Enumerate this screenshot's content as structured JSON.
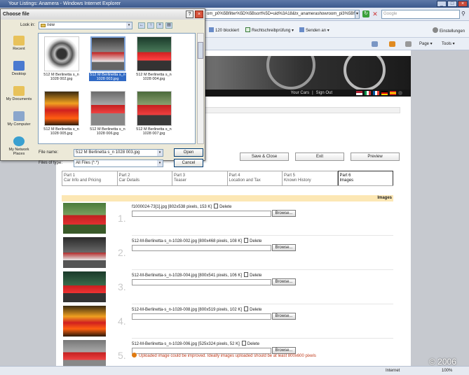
{
  "window": {
    "title": "Your Listings: Anamera - Windows Internet Explorer",
    "address": "om_p0%5Bfilter%5D%5Bsort%5D=uid%3A18&tx_anamerashowroom_pi3%5Bfilter",
    "search_placeholder": "Google"
  },
  "toolbar": {
    "items": [
      "120 blockiert",
      "Rechtschreibprüfung",
      "Senden an",
      "Einstellungen"
    ]
  },
  "nav": {
    "items": [
      "Page",
      "Tools"
    ]
  },
  "banner": {
    "your_cars": "Your Cars",
    "separator": "|",
    "sign_out": "Sign Out"
  },
  "actions": {
    "save_close": "Save & Close",
    "exit": "Exit",
    "preview": "Preview"
  },
  "tabs": [
    {
      "part": "Part 1",
      "label": "Car Info and Pricing"
    },
    {
      "part": "Part 2",
      "label": "Car Details"
    },
    {
      "part": "Part 3",
      "label": "Teaser"
    },
    {
      "part": "Part 4",
      "label": "Location and Tax"
    },
    {
      "part": "Part 5",
      "label": "Known History"
    },
    {
      "part": "Part 6",
      "label": "Images"
    }
  ],
  "images_section": {
    "header": "Images",
    "delete_label": "Delete",
    "browse_label": "Browse...",
    "rows": [
      {
        "num": "1.",
        "info": "f1000024-73[1].jpg [802x538 pixels, 153 K]"
      },
      {
        "num": "2.",
        "info": "512-M-Berlinetta-s_n-1028-002.jpg [800x468 pixels, 108 K]"
      },
      {
        "num": "3.",
        "info": "512-M-Berlinetta-s_n-1028-004.jpg [800x541 pixels, 106 K]"
      },
      {
        "num": "4.",
        "info": "512-M-Berlinetta-s_n-1028-008.jpg [800x519 pixels, 102 K]"
      },
      {
        "num": "5.",
        "info": "512-M-Berlinetta-s_n-1028-006.jpg [525x324 pixels, 52 K]"
      }
    ],
    "warning": "Uploaded image could be improved. Ideally images uploaded should be at least 800x600 pixels"
  },
  "copyright": "© 2006",
  "status": {
    "zone": "Internet",
    "zoom": "100%"
  },
  "dialog": {
    "title": "Choose file",
    "look_in_label": "Look in:",
    "look_in_value": "new",
    "places": [
      "Recent",
      "Desktop",
      "My Documents",
      "My Computer",
      "My Network Places"
    ],
    "files": [
      "512 M Berlinetta s_n 1028 002.jpg",
      "512 M Berlinetta s_n 1028 003.jpg",
      "512 M Berlinetta s_n 1028 004.jpg",
      "512 M Berlinetta s_n 1028 005.jpg",
      "512 M Berlinetta s_n 1028 006.jpg",
      "512 M Berlinetta s_n 1028 007.jpg"
    ],
    "file_name_label": "File name:",
    "file_name_value": "512 M Berlinetta s_n 1028 003.jpg",
    "file_type_label": "Files of type:",
    "file_type_value": "All Files (*.*)",
    "open_button": "Open",
    "cancel_button": "Cancel"
  },
  "colors": {
    "accent": "#316ac5",
    "warning": "#c03a1a",
    "images_header_bg": "#fce7b4"
  }
}
